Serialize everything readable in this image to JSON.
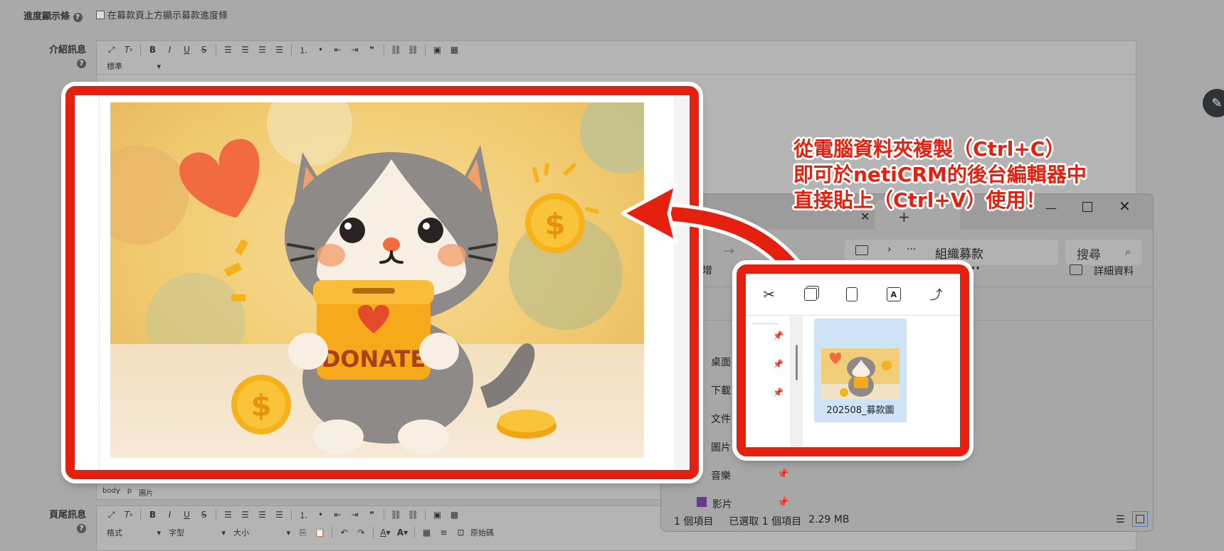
{
  "form": {
    "progress_label": "進度顯示條",
    "progress_checkbox": "在募款頁上方顯示募款進度條",
    "intro_label": "介紹訊息",
    "footer_label": "頁尾訊息",
    "help": "?"
  },
  "editor": {
    "style_dd": "標準",
    "format_dd": "格式",
    "font_dd": "字型",
    "size_dd": "大小",
    "source": "原始碼",
    "path": [
      "body",
      "p",
      "圖片"
    ]
  },
  "annotation": {
    "line1": "從電腦資料夾複製（Ctrl+C）",
    "line2": "即可於netiCRM的後台編輯器中",
    "line3": "直接貼上（Ctrl+V）使用！"
  },
  "image": {
    "donate_text": "DONATE",
    "dollar": "$"
  },
  "explorer": {
    "breadcrumb": "組織募款",
    "search_placeholder": "搜尋",
    "new_label": "新增",
    "details_label": "詳細資料",
    "more": "···",
    "sidebar": [
      "桌面",
      "下載",
      "文件",
      "圖片",
      "音樂",
      "影片"
    ],
    "file_name": "202508_募款圖",
    "status_items": "1 個項目",
    "status_selected": "已選取 1 個項目",
    "status_size": "2.29 MB",
    "tab_close": "✕",
    "tab_add": "+"
  },
  "colors": {
    "accent_red": "#e5200e",
    "coin": "#f6b21b",
    "cat_gray": "#8e8a88"
  }
}
